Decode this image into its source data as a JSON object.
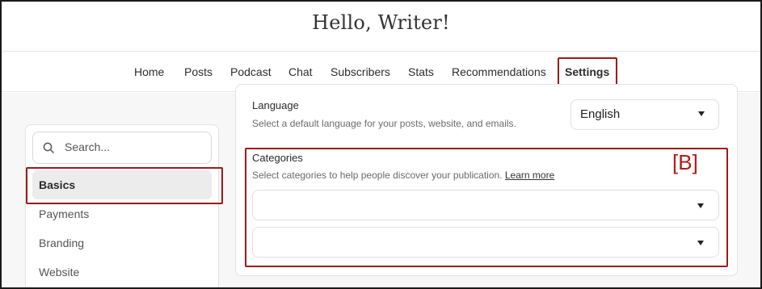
{
  "header": {
    "title": "Hello, Writer!"
  },
  "nav": {
    "items": [
      {
        "label": "Home"
      },
      {
        "label": "Posts"
      },
      {
        "label": "Podcast"
      },
      {
        "label": "Chat"
      },
      {
        "label": "Subscribers"
      },
      {
        "label": "Stats"
      },
      {
        "label": "Recommendations"
      },
      {
        "label": "Settings",
        "active": true
      }
    ]
  },
  "sidebar": {
    "search_placeholder": "Search...",
    "search_icon": "search-icon",
    "items": [
      {
        "label": "Basics",
        "active": true
      },
      {
        "label": "Payments"
      },
      {
        "label": "Branding"
      },
      {
        "label": "Website"
      }
    ]
  },
  "main": {
    "language": {
      "label": "Language",
      "description": "Select a default language for your posts, website, and emails.",
      "selected": "English"
    },
    "categories": {
      "label": "Categories",
      "description": "Select categories to help people discover your publication.",
      "link": "Learn more",
      "selects": [
        "",
        ""
      ]
    }
  },
  "annotation": {
    "marker": "[B]",
    "color": "#b31b1b"
  },
  "colors": {
    "highlight": "#9b1b1b",
    "active_bg": "#ececec"
  }
}
